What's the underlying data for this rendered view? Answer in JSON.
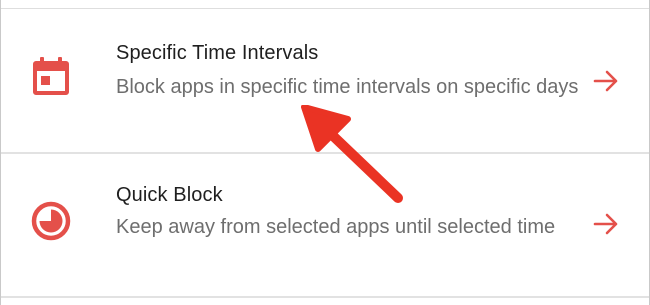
{
  "options": [
    {
      "title": "Specific Time Intervals",
      "description": "Block apps in specific time intervals on specific days",
      "icon": "calendar-icon"
    },
    {
      "title": "Quick Block",
      "description": "Keep away from selected apps until selected time",
      "icon": "timer-icon"
    }
  ],
  "colors": {
    "accent": "#e4504a",
    "annotation": "#ea3324",
    "title": "#1f1f1f",
    "description": "#6e6e6e",
    "divider": "#e2e2e2"
  }
}
